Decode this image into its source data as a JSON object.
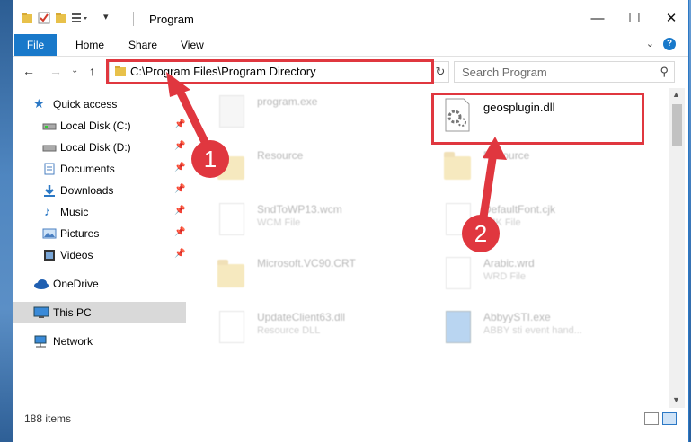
{
  "window": {
    "title": "Program"
  },
  "ribbon": {
    "file": "File",
    "home": "Home",
    "share": "Share",
    "view": "View",
    "help": "?"
  },
  "nav": {
    "address": "C:\\Program Files\\Program Directory",
    "search_placeholder": "Search Program"
  },
  "sidebar": {
    "items": [
      {
        "label": "Quick access",
        "icon": "star-icon"
      },
      {
        "label": "Local Disk (C:)",
        "icon": "drive-icon",
        "pinned": true
      },
      {
        "label": "Local Disk (D:)",
        "icon": "drive-icon",
        "pinned": true
      },
      {
        "label": "Documents",
        "icon": "documents-icon",
        "pinned": true
      },
      {
        "label": "Downloads",
        "icon": "download-icon",
        "pinned": true
      },
      {
        "label": "Music",
        "icon": "music-icon",
        "pinned": true
      },
      {
        "label": "Pictures",
        "icon": "pictures-icon",
        "pinned": true
      },
      {
        "label": "Videos",
        "icon": "videos-icon",
        "pinned": true
      },
      {
        "label": "OneDrive",
        "icon": "cloud-icon"
      },
      {
        "label": "This PC",
        "icon": "computer-icon",
        "selected": true
      },
      {
        "label": "Network",
        "icon": "network-icon"
      }
    ]
  },
  "files": {
    "items": [
      {
        "name": "program.exe",
        "sub": "",
        "kind": "exe"
      },
      {
        "name": "geosplugin.dll",
        "sub": "",
        "kind": "dll"
      },
      {
        "name": "Resource",
        "sub": "",
        "kind": "folder"
      },
      {
        "name": "Resource",
        "sub": "",
        "kind": "folder"
      },
      {
        "name": "SndToWP13.wcm",
        "sub": "WCM File",
        "kind": "doc"
      },
      {
        "name": "DefaultFont.cjk",
        "sub": "CJK File",
        "kind": "doc"
      },
      {
        "name": "Microsoft.VC90.CRT",
        "sub": "",
        "kind": "folder"
      },
      {
        "name": "Arabic.wrd",
        "sub": "WRD File",
        "kind": "doc"
      },
      {
        "name": "UpdateClient63.dll",
        "sub": "Resource DLL",
        "kind": "doc"
      },
      {
        "name": "AbbyySTI.exe",
        "sub": "ABBY sti event hand...",
        "kind": "exe"
      }
    ]
  },
  "status": {
    "count": "188 items"
  },
  "annotations": {
    "marker1": "1",
    "marker2": "2",
    "color": "#e0373f"
  },
  "colors": {
    "accent": "#1979ca",
    "selection": "#d9d9d9"
  }
}
